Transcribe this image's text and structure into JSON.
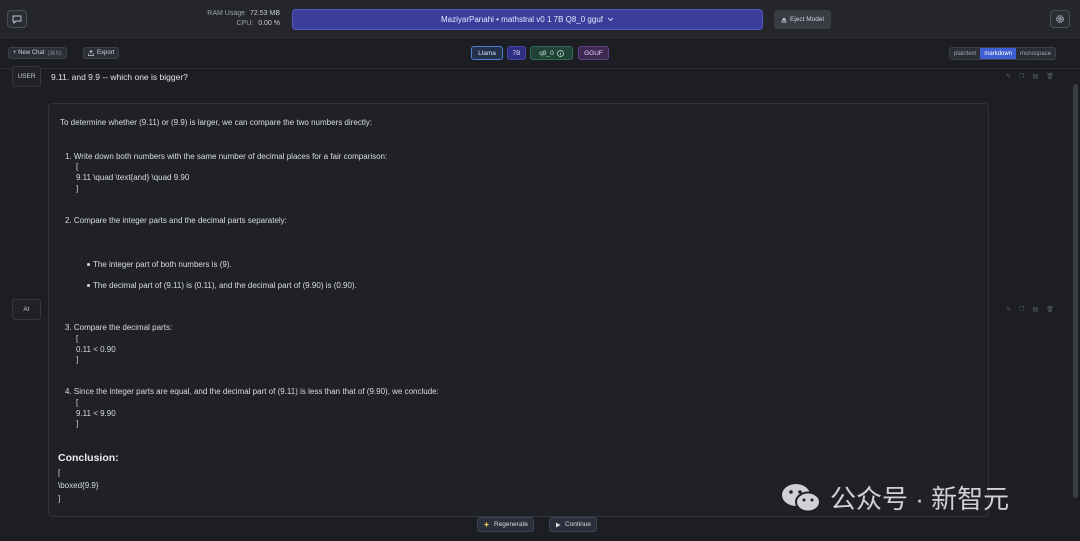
{
  "header": {
    "ram_label": "RAM Usage",
    "ram_value": "72.53 MB",
    "cpu_label": "CPU:",
    "cpu_value": "0.00 %",
    "model_name": "MaziyarPanahi • mathstral v0 1 7B Q8_0 gguf",
    "eject_label": "Eject Model"
  },
  "toolbar": {
    "new_chat_label": "+ New Chat",
    "new_chat_shortcut": "(⌘N)",
    "export_label": "Export",
    "tags": [
      "Llama",
      "7B",
      "q8_0",
      "GGUF"
    ],
    "format_options": [
      "plaintext",
      "markdown",
      "monospace"
    ],
    "format_selected": "markdown"
  },
  "chat": {
    "user_role": "USER",
    "user_message": "9.11. and 9.9 -- which one is bigger?",
    "ai_role": "AI",
    "ai": {
      "intro": "To determine whether (9.11) or (9.9) is larger, we can compare the two numbers directly:",
      "step1": "1. Write down both numbers with the same number of decimal places for a fair comparison:",
      "step1_open": "[",
      "step1_expr": "9.11 \\quad \\text{and} \\quad 9.90",
      "step1_close": "]",
      "step2": "2. Compare the integer parts and the decimal parts separately:",
      "bullet1": "The integer part of both numbers is (9).",
      "bullet2": "The decimal part of (9.11) is (0.11), and the decimal part of (9.90) is (0.90).",
      "step3": "3. Compare the decimal parts:",
      "step3_open": "[",
      "step3_expr": "0.11 < 0.90",
      "step3_close": "]",
      "step4": "4. Since the integer parts are equal, and the decimal part of (9.11) is less than that of (9.90), we conclude:",
      "step4_open": "[",
      "step4_expr": "9.11 < 9.90",
      "step4_close": "]",
      "conclusion_heading": "Conclusion:",
      "conclusion_open": "[",
      "conclusion_expr": "\\boxed{9.9}",
      "conclusion_close": "]"
    }
  },
  "footer": {
    "regenerate_label": "Regenerate",
    "continue_label": "Continue"
  },
  "watermark": {
    "text": "公众号 · 新智元"
  }
}
